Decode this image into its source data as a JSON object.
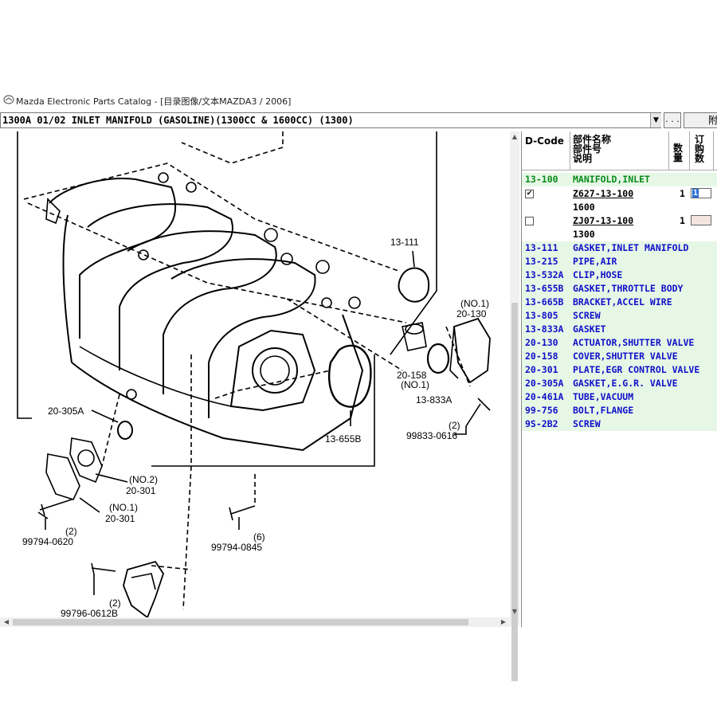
{
  "window": {
    "title": "Mazda Electronic Parts Catalog - [目录图像/文本MAZDA3 / 2006]"
  },
  "toolbar": {
    "group_value": "1300A 01/02 INLET MANIFOLD (GASOLINE)(1300CC & 1600CC) (1300)",
    "dropdown_arrow": "▼",
    "more_label": ". . .",
    "right_label": "附"
  },
  "diagram": {
    "callouts": [
      {
        "id": "c1",
        "text": "13-111"
      },
      {
        "id": "c2",
        "text": "(NO.1)"
      },
      {
        "id": "c3",
        "text": "20-130"
      },
      {
        "id": "c4",
        "text": "20-158"
      },
      {
        "id": "c5",
        "text": "(NO.1)"
      },
      {
        "id": "c6",
        "text": "13-833A"
      },
      {
        "id": "c7",
        "text": "(2)"
      },
      {
        "id": "c8",
        "text": "99833-0616"
      },
      {
        "id": "c9",
        "text": "13-655B"
      },
      {
        "id": "c10",
        "text": "20-305A"
      },
      {
        "id": "c11",
        "text": "(NO.2)"
      },
      {
        "id": "c12",
        "text": "20-301"
      },
      {
        "id": "c13",
        "text": "(NO.1)"
      },
      {
        "id": "c14",
        "text": "20-301"
      },
      {
        "id": "c15",
        "text": "(2)"
      },
      {
        "id": "c16",
        "text": "99794-0620"
      },
      {
        "id": "c17",
        "text": "(6)"
      },
      {
        "id": "c18",
        "text": "99794-0845"
      },
      {
        "id": "c19",
        "text": "(2)"
      },
      {
        "id": "c20",
        "text": "99796-0612B"
      }
    ]
  },
  "parts_table": {
    "headers": {
      "dcode": "D-Code",
      "name1": "部件名称",
      "name2": "部件号",
      "name3": "说明",
      "qty": "数量",
      "order": "订购数"
    },
    "category": {
      "code": "13-100",
      "name": "MANIFOLD,INLET"
    },
    "parts": [
      {
        "checked": "✔",
        "number": "Z627-13-100",
        "variant": "1600",
        "qty": "1",
        "order": "1"
      },
      {
        "checked": "",
        "number": "ZJ07-13-100",
        "variant": "1300",
        "qty": "1",
        "order": ""
      }
    ],
    "rows": [
      {
        "code": "13-111",
        "name": "GASKET,INLET MANIFOLD"
      },
      {
        "code": "13-215",
        "name": "PIPE,AIR"
      },
      {
        "code": "13-532A",
        "name": "CLIP,HOSE"
      },
      {
        "code": "13-655B",
        "name": "GASKET,THROTTLE BODY"
      },
      {
        "code": "13-665B",
        "name": "BRACKET,ACCEL WIRE"
      },
      {
        "code": "13-805",
        "name": "SCREW"
      },
      {
        "code": "13-833A",
        "name": "GASKET"
      },
      {
        "code": "20-130",
        "name": "ACTUATOR,SHUTTER VALVE"
      },
      {
        "code": "20-158",
        "name": "COVER,SHUTTER VALVE"
      },
      {
        "code": "20-301",
        "name": "PLATE,EGR CONTROL VALVE"
      },
      {
        "code": "20-305A",
        "name": "GASKET,E.G.R. VALVE"
      },
      {
        "code": "20-461A",
        "name": "TUBE,VACUUM"
      },
      {
        "code": "99-756",
        "name": "BOLT,FLANGE"
      },
      {
        "code": "9S-2B2",
        "name": "SCREW"
      }
    ]
  },
  "colors": {
    "category_text": "#0a8a1a",
    "subpart_text": "#1010c8",
    "row_bg": "#e6f7e6",
    "selection": "#2a6fd6"
  }
}
